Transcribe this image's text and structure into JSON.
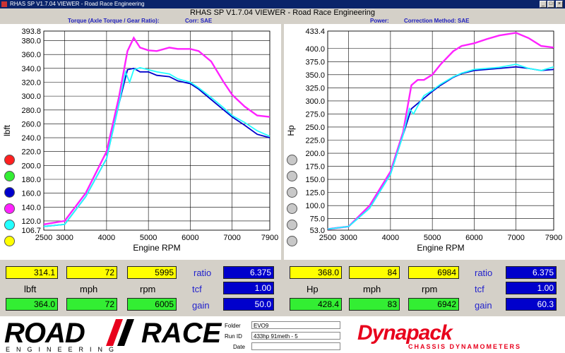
{
  "window": {
    "title": "RHAS SP V1.7.04 VIEWER - Road Race Engineering"
  },
  "app_title": "RHAS SP V1.7.04 VIEWER - Road Race Engineering",
  "torque": {
    "header": "Torque (Axle Torque / Gear Ratio):",
    "corr": "Corr: SAE",
    "ylabel": "lbft",
    "xlabel": "Engine RPM",
    "yticks": [
      "393.8",
      "380.0",
      "360.0",
      "340.0",
      "320.0",
      "300.0",
      "280.0",
      "260.0",
      "240.0",
      "220.0",
      "200.0",
      "180.0",
      "160.0",
      "140.0",
      "120.0",
      "106.7"
    ],
    "xticks": [
      "2500",
      "3000",
      "4000",
      "5000",
      "6000",
      "7000",
      "7900"
    ],
    "run_colors": [
      "#ff2020",
      "#33ee33",
      "#0000cc",
      "#ff22ff",
      "#22ffff",
      "#ffff00"
    ],
    "readout": {
      "val": "314.1",
      "mph": "72",
      "rpm": "5995",
      "ratio": "6.375",
      "tcf": "1.00",
      "gain": "50.0",
      "peak_val": "364.0",
      "peak_mph": "72",
      "peak_rpm": "6005",
      "unit_label": "lbft",
      "mph_label": "mph",
      "rpm_label": "rpm",
      "ratio_label": "ratio",
      "tcf_label": "tcf",
      "gain_label": "gain"
    }
  },
  "power": {
    "header": "Power:",
    "corr": "Correction Method: SAE",
    "ylabel": "Hp",
    "xlabel": "Engine RPM",
    "yticks": [
      "433.4",
      "400.0",
      "375.0",
      "350.0",
      "325.0",
      "300.0",
      "275.0",
      "250.0",
      "225.0",
      "200.0",
      "175.0",
      "150.0",
      "125.0",
      "100.0",
      "75.0",
      "53.0"
    ],
    "xticks": [
      "2500",
      "3000",
      "4000",
      "5000",
      "6000",
      "7000",
      "7900"
    ],
    "readout": {
      "val": "368.0",
      "mph": "84",
      "rpm": "6984",
      "ratio": "6.375",
      "tcf": "1.00",
      "gain": "60.3",
      "peak_val": "428.4",
      "peak_mph": "83",
      "peak_rpm": "6942",
      "unit_label": "Hp",
      "mph_label": "mph",
      "rpm_label": "rpm",
      "ratio_label": "ratio",
      "tcf_label": "tcf",
      "gain_label": "gain"
    }
  },
  "footer": {
    "logo_road": "ROAD",
    "logo_race": "RACE",
    "logo_sub": "ENGINEERING",
    "folder_label": "Folder",
    "folder_value": "EVO9",
    "runid_label": "Run ID",
    "runid_value": "433hp 91meth - 5",
    "date_label": "Date",
    "date_value": "",
    "dyna": "Dynapack",
    "dyna_sub": "CHASSIS DYNAMOMETERS"
  },
  "chart_data": [
    {
      "type": "line",
      "ylabel": "lbft",
      "xlabel": "Engine RPM",
      "xlim": [
        2500,
        7900
      ],
      "ylim": [
        106.7,
        393.8
      ],
      "series": [
        {
          "color": "#ff22ff",
          "x": [
            2500,
            3000,
            3500,
            4000,
            4300,
            4500,
            4650,
            4800,
            5000,
            5200,
            5500,
            5700,
            6000,
            6200,
            6500,
            6800,
            7000,
            7300,
            7600,
            7900
          ],
          "y": [
            115,
            120,
            160,
            220,
            300,
            365,
            384,
            370,
            366,
            365,
            370,
            368,
            368,
            365,
            350,
            320,
            302,
            285,
            272,
            270
          ]
        },
        {
          "color": "#0000cc",
          "x": [
            2500,
            3000,
            3500,
            4000,
            4300,
            4500,
            4650,
            4800,
            5000,
            5200,
            5500,
            5700,
            6000,
            6200,
            6500,
            6800,
            7000,
            7300,
            7600,
            7900
          ],
          "y": [
            112,
            115,
            155,
            210,
            290,
            338,
            340,
            335,
            335,
            330,
            328,
            322,
            318,
            310,
            295,
            280,
            270,
            258,
            245,
            240
          ]
        },
        {
          "color": "#22ffff",
          "x": [
            2500,
            3000,
            3500,
            4000,
            4300,
            4450,
            4550,
            4650,
            4800,
            5000,
            5200,
            5500,
            5700,
            6000,
            6200,
            6500,
            6800,
            7000,
            7300,
            7600,
            7900
          ],
          "y": [
            112,
            115,
            155,
            210,
            290,
            335,
            320,
            338,
            341,
            338,
            335,
            332,
            325,
            320,
            312,
            298,
            283,
            272,
            262,
            250,
            242
          ]
        }
      ]
    },
    {
      "type": "line",
      "ylabel": "Hp",
      "xlabel": "Engine RPM",
      "xlim": [
        2500,
        7900
      ],
      "ylim": [
        53.0,
        433.4
      ],
      "series": [
        {
          "color": "#ff22ff",
          "x": [
            2500,
            3000,
            3500,
            4000,
            4300,
            4500,
            4650,
            4800,
            5000,
            5200,
            5500,
            5700,
            6000,
            6300,
            6600,
            7000,
            7300,
            7600,
            7900
          ],
          "y": [
            55,
            60,
            100,
            165,
            240,
            330,
            340,
            340,
            350,
            370,
            395,
            405,
            410,
            418,
            425,
            430,
            420,
            405,
            402
          ]
        },
        {
          "color": "#0000cc",
          "x": [
            2500,
            3000,
            3500,
            4000,
            4300,
            4500,
            4650,
            4800,
            5000,
            5200,
            5500,
            5700,
            6000,
            6300,
            6600,
            7000,
            7300,
            7600,
            7900
          ],
          "y": [
            55,
            60,
            95,
            160,
            235,
            285,
            295,
            305,
            318,
            330,
            345,
            352,
            358,
            360,
            362,
            365,
            362,
            358,
            360
          ]
        },
        {
          "color": "#22ffff",
          "x": [
            2500,
            3000,
            3500,
            4000,
            4300,
            4450,
            4550,
            4650,
            4800,
            5000,
            5200,
            5500,
            5700,
            6000,
            6300,
            6600,
            7000,
            7300,
            7600,
            7900
          ],
          "y": [
            55,
            60,
            95,
            160,
            235,
            285,
            275,
            290,
            310,
            320,
            332,
            346,
            353,
            360,
            362,
            364,
            370,
            362,
            358,
            365
          ]
        }
      ]
    }
  ]
}
